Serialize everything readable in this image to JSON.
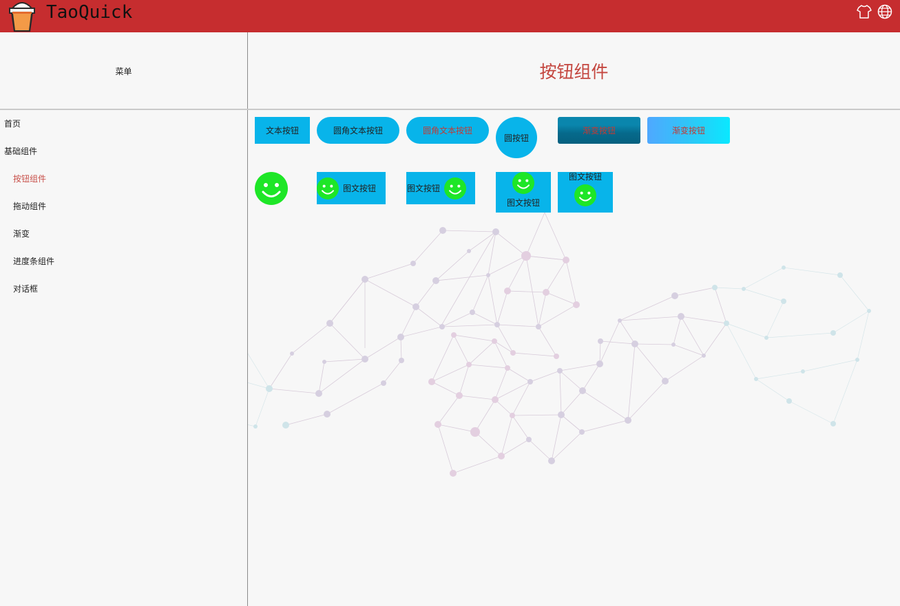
{
  "app": {
    "title": "TaoQuick"
  },
  "titlebar": {
    "skin_icon": "tshirt-icon",
    "lang_icon": "globe-icon",
    "bg_color": "#c62d2f"
  },
  "sidebar": {
    "header": "菜单",
    "items": [
      {
        "label": "首页",
        "level": 0
      },
      {
        "label": "基础组件",
        "level": 0
      },
      {
        "label": "按钮组件",
        "level": 1,
        "active": true
      },
      {
        "label": "拖动组件",
        "level": 1
      },
      {
        "label": "渐变",
        "level": 1
      },
      {
        "label": "进度条组件",
        "level": 1
      },
      {
        "label": "对话框",
        "level": 1
      }
    ]
  },
  "content": {
    "title": "按钮组件",
    "buttons": {
      "text_button": "文本按钮",
      "round_text_button_1": "圆角文本按钮",
      "round_text_button_2": "圆角文本按钮",
      "circle_button": "圆按钮",
      "gradient_button_1": "渐变按钮",
      "gradient_button_2": "渐变按钮",
      "image_text_1": "图文按钮",
      "image_text_2": "图文按钮",
      "image_text_3": "图文按钮",
      "image_text_4": "图文按钮"
    }
  },
  "colors": {
    "accent": "#08b4ea",
    "brand": "#c62d2f",
    "active_text": "#c8504a",
    "smile": "#1ee627"
  }
}
